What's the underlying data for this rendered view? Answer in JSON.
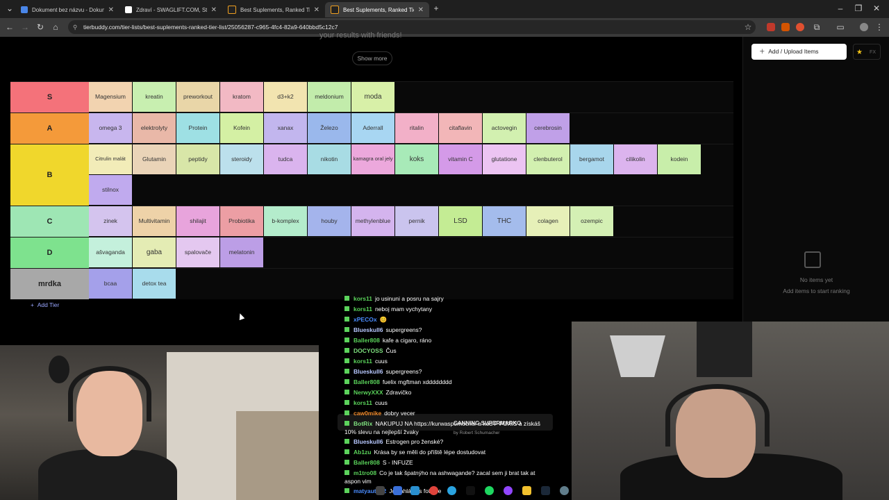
{
  "browser": {
    "tabs": [
      {
        "label": "Dokument bez názvu - Dokum",
        "color": "#4a86e8"
      },
      {
        "label": "Zdraví - SWAGLIFT.COM, Strana",
        "color": "#ffffff"
      },
      {
        "label": "Best Suplements, Ranked Tier L",
        "color": "#111111"
      },
      {
        "label": "Best Suplements, Ranked Tier L",
        "color": "#111111"
      }
    ],
    "url": "tierbuddy.com/tier-lists/best-suplements-ranked-tier-list/25056287-c965-4fc4-82a9-640bbd5c12c7"
  },
  "page": {
    "top_fragment": "your results with friends!",
    "show_more": "Show more",
    "add_tier": "Add Tier",
    "tiers": [
      {
        "label": "S",
        "color": "#f4727a",
        "items": [
          {
            "name": "Magensium",
            "color": "#f2d3b0"
          },
          {
            "name": "kreatin",
            "color": "#c8efb0"
          },
          {
            "name": "preworkout",
            "color": "#e9d6a8"
          },
          {
            "name": "kratom",
            "color": "#f2b9c4"
          },
          {
            "name": "d3+k2",
            "color": "#f2e4b0"
          },
          {
            "name": "meldonium",
            "color": "#c2ecab"
          },
          {
            "name": "moda",
            "color": "#d8f0a8"
          }
        ]
      },
      {
        "label": "A",
        "color": "#f49a3a",
        "items": [
          {
            "name": "omega 3",
            "color": "#c8b6ee"
          },
          {
            "name": "elektrolyty",
            "color": "#e9b8a8"
          },
          {
            "name": "Protein",
            "color": "#9ee0e4"
          },
          {
            "name": "Kofein",
            "color": "#d4f0a4"
          },
          {
            "name": "xanax",
            "color": "#c2b6ee"
          },
          {
            "name": "Železo",
            "color": "#9ab8ec"
          },
          {
            "name": "Aderrall",
            "color": "#a8d6f2"
          },
          {
            "name": "ritalin",
            "color": "#f2b0c8"
          },
          {
            "name": "citaflavin",
            "color": "#f2b6b8"
          },
          {
            "name": "actovegin",
            "color": "#d2f0b0"
          },
          {
            "name": "cerebrosin",
            "color": "#c0a0e8"
          }
        ]
      },
      {
        "label": "B",
        "color": "#f0d72c",
        "items": [
          {
            "name": "Citrulin malát",
            "color": "#f2ecb8"
          },
          {
            "name": "Glutamin",
            "color": "#ead4b8"
          },
          {
            "name": "peptidy",
            "color": "#d8e6a8"
          },
          {
            "name": "steroidy",
            "color": "#bce0ec"
          },
          {
            "name": "tudca",
            "color": "#dab4ee"
          },
          {
            "name": "nikotin",
            "color": "#a8dce4"
          },
          {
            "name": "kamagra oral jely",
            "color": "#eca8dc"
          },
          {
            "name": "koks",
            "color": "#a8eab8"
          },
          {
            "name": "vitamin C",
            "color": "#d49ae8"
          },
          {
            "name": "glutatione",
            "color": "#ecc4f2"
          },
          {
            "name": "clenbuterol",
            "color": "#d2f0b0"
          },
          {
            "name": "bergamot",
            "color": "#a8d6ec"
          },
          {
            "name": "cilikolin",
            "color": "#dcb4ee"
          },
          {
            "name": "kodein",
            "color": "#c8eeaa"
          },
          {
            "name": "stilnox",
            "color": "#c0aaee"
          }
        ]
      },
      {
        "label": "C",
        "color": "#9ee6b4",
        "items": [
          {
            "name": "zinek",
            "color": "#d4c4ee"
          },
          {
            "name": "Multivitamin",
            "color": "#eed2a8"
          },
          {
            "name": "shilajit",
            "color": "#e8a4dc"
          },
          {
            "name": "Probiotika",
            "color": "#ec9ea4"
          },
          {
            "name": "b-komplex",
            "color": "#b4eccc"
          },
          {
            "name": "houby",
            "color": "#a4b4ec"
          },
          {
            "name": "methylenblue",
            "color": "#d4b4ee"
          },
          {
            "name": "pernik",
            "color": "#cac4ee"
          },
          {
            "name": "LSD",
            "color": "#c4ec94"
          },
          {
            "name": "THC",
            "color": "#a4bcec"
          },
          {
            "name": "colagen",
            "color": "#e6f0b8"
          },
          {
            "name": "ozempic",
            "color": "#d4f0b4"
          }
        ]
      },
      {
        "label": "D",
        "color": "#7ee28e",
        "items": [
          {
            "name": "ašvaganda",
            "color": "#c4f0dc"
          },
          {
            "name": "gaba",
            "color": "#e4ecb4"
          },
          {
            "name": "spalovače",
            "color": "#e4c8f0"
          },
          {
            "name": "melatonin",
            "color": "#bc9ee6"
          }
        ]
      },
      {
        "label": "mrdka",
        "color": "#a8a8a8",
        "items": [
          {
            "name": "bcaa",
            "color": "#a4a0ea"
          },
          {
            "name": "detox tea",
            "color": "#a8dcec"
          }
        ]
      }
    ]
  },
  "side_panel": {
    "add_upload": "Add / Upload Items",
    "fx": "FX",
    "empty_title": "No items yet",
    "empty_sub": "Add items to start ranking"
  },
  "chat": [
    {
      "user": "kors11",
      "text": "jo usinuni a posru na sajry",
      "color": "#5ad35a"
    },
    {
      "user": "kors11",
      "text": "neboj mam vychytany",
      "color": "#5ad35a"
    },
    {
      "user": "xPECOx",
      "text": "😊",
      "color": "#4a8cff"
    },
    {
      "user": "Blueskull6",
      "text": "supergreens?",
      "color": "#b8c8ff"
    },
    {
      "user": "Baller808",
      "text": "kafe a cigaro, ráno",
      "color": "#5ad35a"
    },
    {
      "user": "DOCYOSS",
      "text": "Čus",
      "color": "#7ee07e"
    },
    {
      "user": "kors11",
      "text": "cuus",
      "color": "#5ad35a"
    },
    {
      "user": "Blueskull6",
      "text": "supergreens?",
      "color": "#b8c8ff"
    },
    {
      "user": "Baller808",
      "text": "fuelix mgftman xdddddddd",
      "color": "#5ad35a"
    },
    {
      "user": "NerwyXXX",
      "text": "Zdravičko",
      "color": "#5ad35a"
    },
    {
      "user": "kors11",
      "text": "cuus",
      "color": "#5ad35a"
    },
    {
      "user": "caw0mike",
      "text": "dobry vecer",
      "color": "#f08a2a"
    },
    {
      "user": "BotRix",
      "text": "NAKUPUJ NA https://kurwaspomocne/ a kód F FOXIS a získáš 10% slevu na nejlepší žvaky",
      "color": "#7ee07e"
    },
    {
      "user": "Blueskull6",
      "text": "Estrogen pro ženské?",
      "color": "#b8c8ff"
    },
    {
      "user": "Ab1zu",
      "text": "Krása by se měli do příště lépe dostudovat",
      "color": "#5ad35a"
    },
    {
      "user": "Baller808",
      "text": "S - INFUZE",
      "color": "#5ad35a"
    },
    {
      "user": "m1tro08",
      "text": "Co je tak špatnýho na ashwagande? zacal sem ji brat tak at aspon vim",
      "color": "#5ad35a"
    },
    {
      "user": "matyauto12",
      "text": "Jo zahlásíes fotbale",
      "color": "#4a8cff"
    }
  ],
  "mini_player": {
    "title": "CANNING SUPERMARKO",
    "sub": "by Robert Schumacher"
  },
  "colors": {
    "page_bg": "#000000",
    "accent": "#9aa7ff"
  }
}
